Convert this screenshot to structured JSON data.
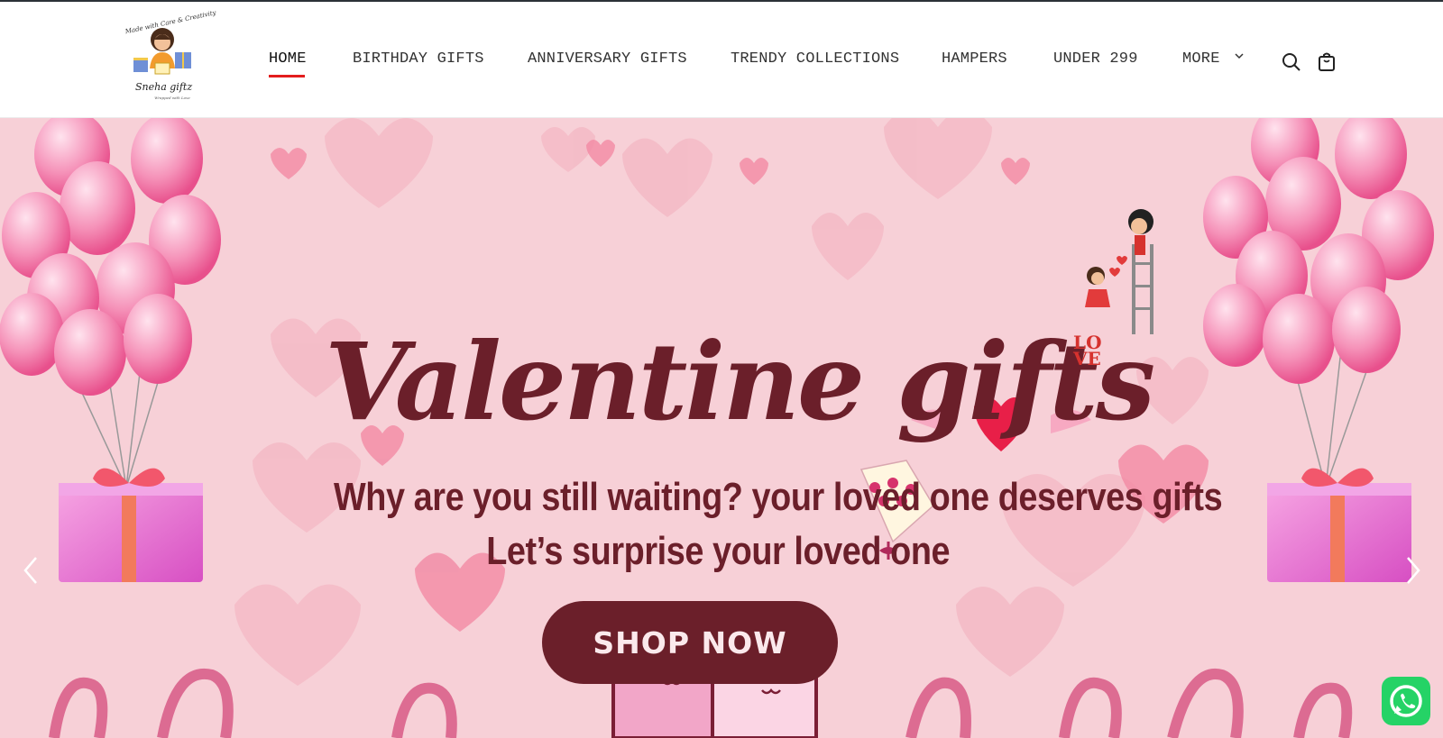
{
  "brand": {
    "logo_line1": "Made with Care & Creativity",
    "logo_name": "Sneha giftz",
    "logo_tagline": "Wrapped with Love"
  },
  "nav": {
    "items": [
      {
        "label": "HOME",
        "active": true
      },
      {
        "label": "BIRTHDAY GIFTS"
      },
      {
        "label": "ANNIVERSARY GIFTS"
      },
      {
        "label": "TRENDY COLLECTIONS"
      },
      {
        "label": "HAMPERS"
      },
      {
        "label": "UNDER 299"
      },
      {
        "label": "MORE"
      }
    ],
    "active_color": "#e31d1d"
  },
  "icons": {
    "search": "search-icon",
    "cart": "shopping-bag-icon",
    "more_dropdown": "chevron-down-icon",
    "prev": "chevron-left-icon",
    "next": "chevron-right-icon",
    "whatsapp": "whatsapp-icon"
  },
  "hero": {
    "title": "Valentine gifts",
    "love_badge_top": "LO",
    "love_badge_bottom": "VE",
    "line1": "Why are you still waiting? your loved one deserves gifts",
    "line2": "Let’s surprise your loved one",
    "cta": "SHOP NOW",
    "background_color": "#f7d0d7",
    "text_color": "#6b1f2a"
  }
}
